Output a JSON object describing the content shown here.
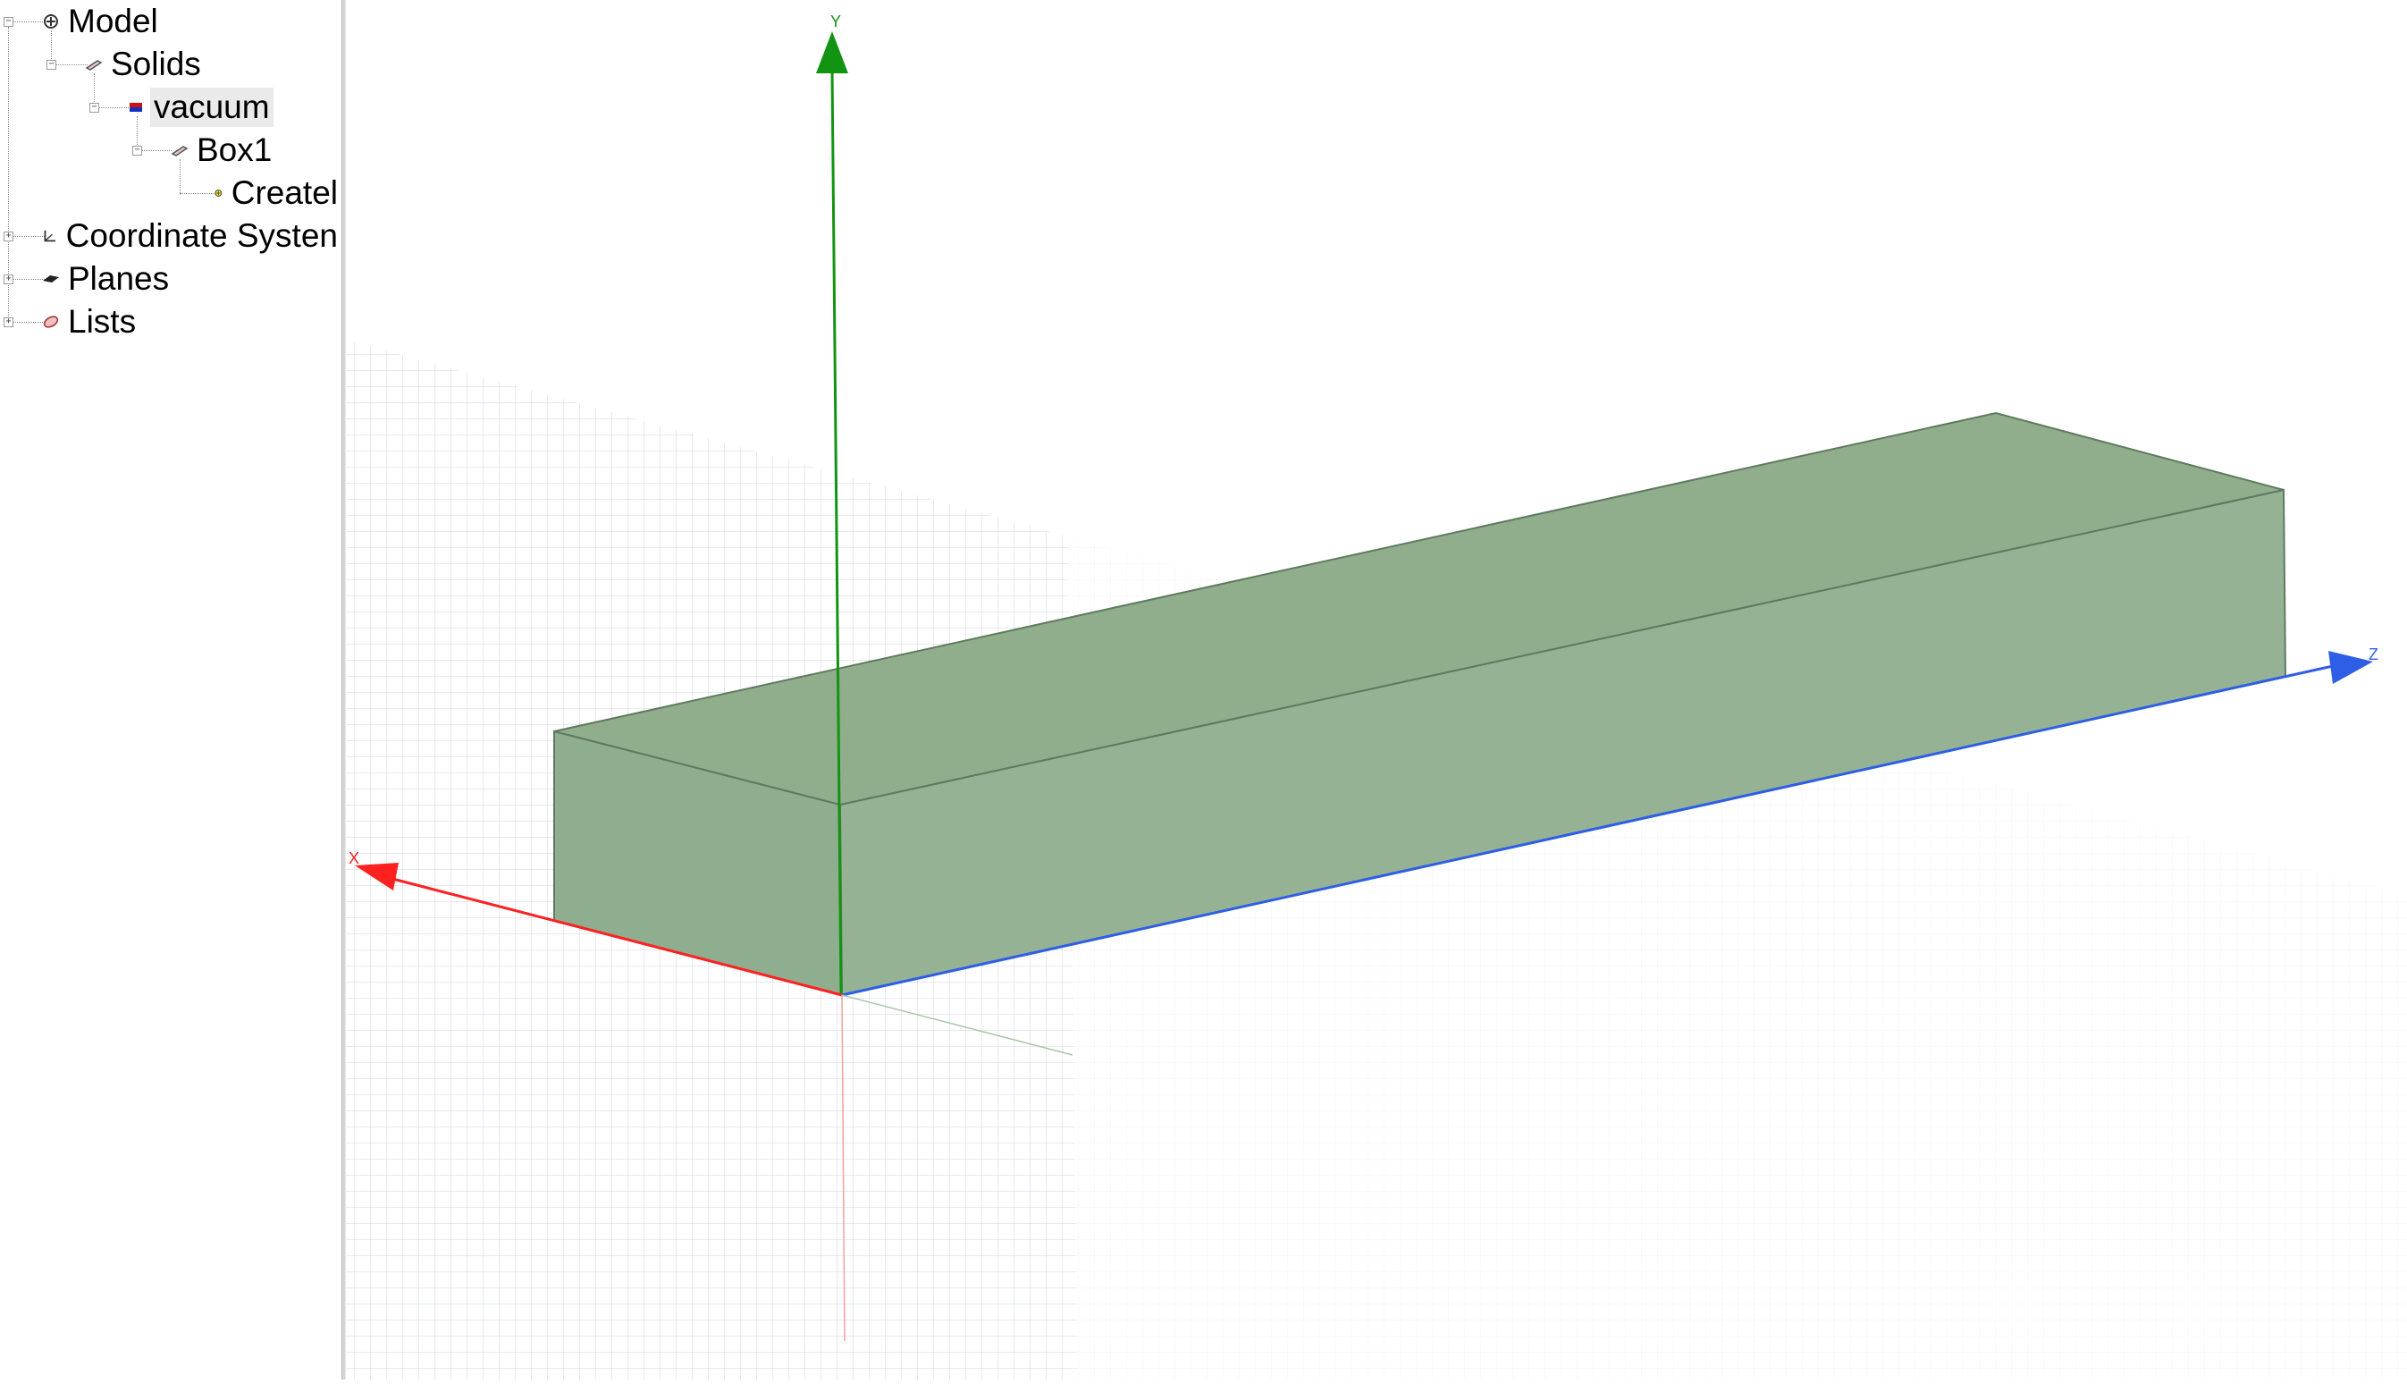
{
  "tree": {
    "items": [
      {
        "label": "Model",
        "icon": "model-icon",
        "expander": "−"
      },
      {
        "label": "Solids",
        "icon": "solid-icon",
        "expander": "−"
      },
      {
        "label": "vacuum",
        "icon": "material-icon",
        "expander": "−"
      },
      {
        "label": "Box1",
        "icon": "solid-icon",
        "expander": "−"
      },
      {
        "label": "Createl",
        "icon": "create-box-icon"
      },
      {
        "label": "Coordinate Systen",
        "icon": "coordinate-system-icon",
        "expander": "+"
      },
      {
        "label": "Planes",
        "icon": "planes-icon",
        "expander": "+"
      },
      {
        "label": "Lists",
        "icon": "lists-icon",
        "expander": "+"
      }
    ]
  },
  "viewport": {
    "axes": {
      "x_label": "X",
      "y_label": "Y",
      "z_label": "Z"
    },
    "colors": {
      "x_axis": "#ff2020",
      "y_axis": "#129412",
      "z_axis": "#2e5ee6",
      "box_front": "#8fad8f",
      "box_side": "#95b394",
      "box_top": "#90ad8c",
      "grid": "#c9cbdf"
    }
  }
}
